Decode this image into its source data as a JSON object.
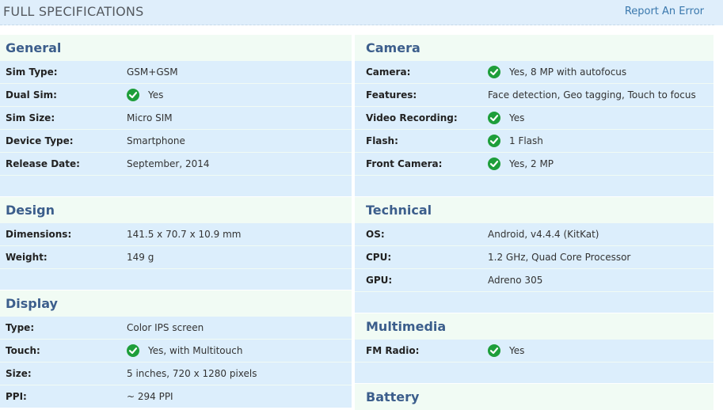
{
  "header": {
    "title": "FULL SPECIFICATIONS",
    "report_link": "Report An Error"
  },
  "colors": {
    "row_bg": "#dceefc",
    "section_bg": "#f1fbf4",
    "section_title": "#3c5e8c",
    "check_green": "#1e9e3a",
    "link": "#3a78ad"
  },
  "left": {
    "general": {
      "title": "General",
      "rows": [
        {
          "label": "Sim Type:",
          "value": "GSM+GSM",
          "check": false
        },
        {
          "label": "Dual Sim:",
          "value": "Yes",
          "check": true
        },
        {
          "label": "Sim Size:",
          "value": "Micro SIM",
          "check": false
        },
        {
          "label": "Device Type:",
          "value": "Smartphone",
          "check": false
        },
        {
          "label": "Release Date:",
          "value": "September, 2014",
          "check": false
        }
      ]
    },
    "design": {
      "title": "Design",
      "rows": [
        {
          "label": "Dimensions:",
          "value": "141.5 x 70.7 x 10.9 mm",
          "check": false
        },
        {
          "label": "Weight:",
          "value": "149 g",
          "check": false
        }
      ]
    },
    "display": {
      "title": "Display",
      "rows": [
        {
          "label": "Type:",
          "value": "Color IPS screen",
          "check": false
        },
        {
          "label": "Touch:",
          "value": "Yes, with Multitouch",
          "check": true
        },
        {
          "label": "Size:",
          "value": "5 inches, 720 x 1280 pixels",
          "check": false
        },
        {
          "label": "PPI:",
          "value": "~ 294 PPI",
          "check": false
        }
      ]
    }
  },
  "right": {
    "camera": {
      "title": "Camera",
      "rows": [
        {
          "label": "Camera:",
          "value": "Yes, 8 MP with autofocus",
          "check": true
        },
        {
          "label": "Features:",
          "value": "Face detection, Geo tagging, Touch to focus",
          "check": false
        },
        {
          "label": "Video Recording:",
          "value": "Yes",
          "check": true
        },
        {
          "label": "Flash:",
          "value": "1 Flash",
          "check": true
        },
        {
          "label": "Front Camera:",
          "value": "Yes, 2 MP",
          "check": true
        }
      ]
    },
    "technical": {
      "title": "Technical",
      "rows": [
        {
          "label": "OS:",
          "value": "Android, v4.4.4 (KitKat)",
          "check": false
        },
        {
          "label": "CPU:",
          "value": "1.2 GHz, Quad Core Processor",
          "check": false
        },
        {
          "label": "GPU:",
          "value": "Adreno 305",
          "check": false
        }
      ]
    },
    "multimedia": {
      "title": "Multimedia",
      "rows": [
        {
          "label": "FM Radio:",
          "value": "Yes",
          "check": true
        }
      ]
    },
    "battery": {
      "title": "Battery"
    }
  }
}
